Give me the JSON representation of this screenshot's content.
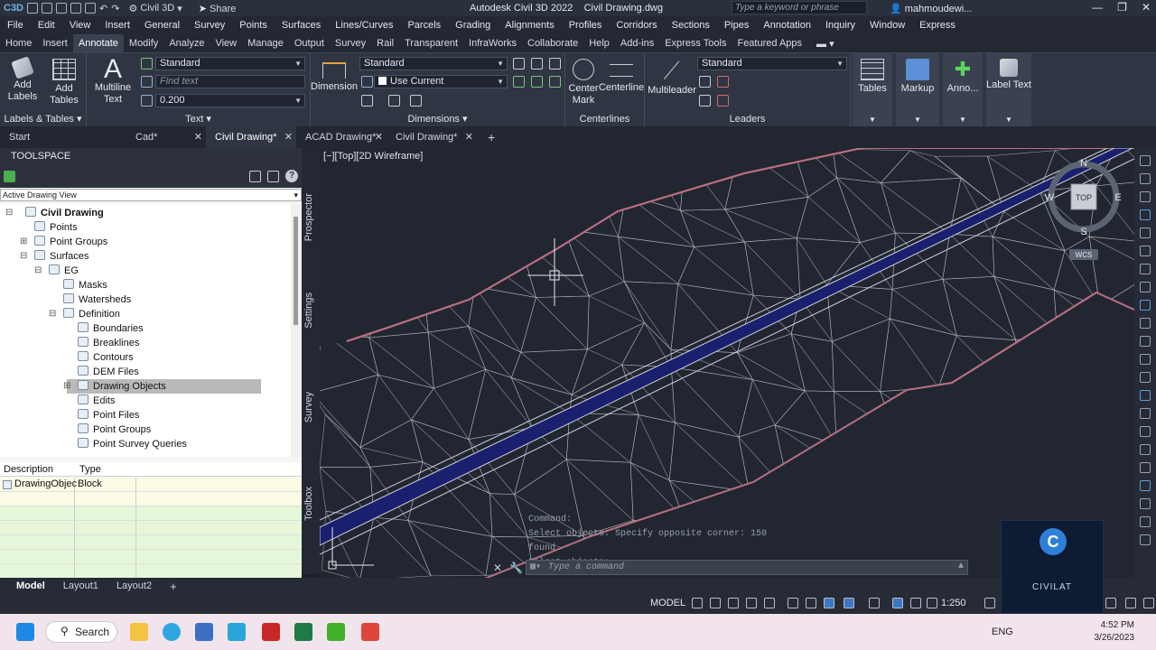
{
  "titlebar": {
    "workspace": "Civil 3D",
    "share": "Share",
    "app_title": "Autodesk Civil 3D 2022",
    "doc_title": "Civil Drawing.dwg",
    "search_placeholder": "Type a keyword or phrase",
    "user": "mahmoudewi..."
  },
  "menu": [
    "File",
    "Edit",
    "View",
    "Insert",
    "General",
    "Survey",
    "Points",
    "Surfaces",
    "Lines/Curves",
    "Parcels",
    "Grading",
    "Alignments",
    "Profiles",
    "Corridors",
    "Sections",
    "Pipes",
    "Annotation",
    "Inquiry",
    "Window",
    "Express"
  ],
  "ribbon_tabs": [
    "Home",
    "Insert",
    "Annotate",
    "Modify",
    "Analyze",
    "View",
    "Manage",
    "Output",
    "Survey",
    "Rail",
    "Transparent",
    "InfraWorks",
    "Collaborate",
    "Help",
    "Add-ins",
    "Express Tools",
    "Featured Apps"
  ],
  "ribbon_active_tab": "Annotate",
  "ribbon": {
    "labels_tables": {
      "title": "Labels & Tables",
      "add_labels": "Add Labels",
      "add_tables": "Add Tables"
    },
    "text": {
      "title": "Text",
      "multiline": "Multiline Text",
      "style": "Standard",
      "find_placeholder": "Find text",
      "height": "0.200"
    },
    "dimensions": {
      "title": "Dimensions",
      "dimension": "Dimension",
      "style": "Standard",
      "layer": "Use Current"
    },
    "centerlines": {
      "title": "Centerlines",
      "center_mark": "Center Mark",
      "centerline": "Centerline"
    },
    "leaders": {
      "title": "Leaders",
      "multileader": "Multileader",
      "style": "Standard"
    },
    "extra": {
      "tables": "Tables",
      "markup": "Markup",
      "anno": "Anno...",
      "label_text": "Label Text"
    }
  },
  "doc_tabs": [
    {
      "label": "Start",
      "active": false,
      "closable": false
    },
    {
      "label": "Cad*",
      "active": false,
      "closable": true
    },
    {
      "label": "Civil Drawing*",
      "active": true,
      "closable": true
    },
    {
      "label": "ACAD Drawing*",
      "active": false,
      "closable": true
    },
    {
      "label": "Civil Drawing*",
      "active": false,
      "closable": true
    }
  ],
  "toolspace": {
    "title": "TOOLSPACE",
    "view": "Active Drawing View",
    "tree": [
      {
        "label": "Civil Drawing",
        "bold": true
      },
      {
        "label": "Points"
      },
      {
        "label": "Point Groups"
      },
      {
        "label": "Surfaces"
      },
      {
        "label": "EG"
      },
      {
        "label": "Masks"
      },
      {
        "label": "Watersheds"
      },
      {
        "label": "Definition"
      },
      {
        "label": "Boundaries"
      },
      {
        "label": "Breaklines"
      },
      {
        "label": "Contours"
      },
      {
        "label": "DEM Files"
      },
      {
        "label": "Drawing Objects",
        "selected": true
      },
      {
        "label": "Edits"
      },
      {
        "label": "Point Files"
      },
      {
        "label": "Point Groups"
      },
      {
        "label": "Point Survey Queries"
      }
    ],
    "table": {
      "headers": [
        "Description",
        "Type"
      ],
      "rows": [
        [
          "DrawingObjec",
          "Block"
        ]
      ]
    },
    "side_tabs": [
      "Prospector",
      "Settings",
      "Survey",
      "Toolbox"
    ]
  },
  "viewport": {
    "label": "[−][Top][2D Wireframe]",
    "viewcube": {
      "top": "TOP",
      "n": "N",
      "s": "S",
      "e": "E",
      "w": "W",
      "wcs": "WCS"
    },
    "command_history": [
      "Command:",
      "Select objects: Specify opposite corner: 150 found",
      "Select objects:"
    ],
    "command_placeholder": "Type a command"
  },
  "layout_tabs": [
    {
      "label": "Model",
      "active": true
    },
    {
      "label": "Layout1",
      "active": false
    },
    {
      "label": "Layout2",
      "active": false
    }
  ],
  "statusbar": {
    "model": "MODEL",
    "scale": "1:250"
  },
  "taskbar": {
    "search": "Search",
    "lang": "ENG",
    "time": "4:52 PM",
    "date": "3/26/2023"
  },
  "watermark": {
    "letter": "C",
    "name": "CIVILAT"
  },
  "colors": {
    "surface_boundary": "#b8707f",
    "tin_lines": "#b9bcc2",
    "alignment_fill": "#1a1f6e",
    "viewport_bg": "#212630"
  }
}
